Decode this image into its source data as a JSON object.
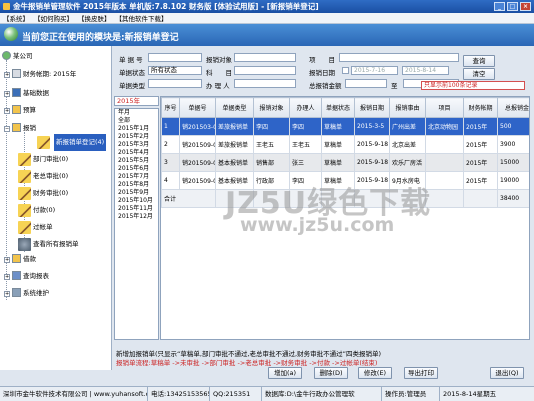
{
  "window": {
    "title": "金牛报销单管理软件 2015年版本 单机版:7.8.102 财务版 [体验试用版] - [新报销单登记]"
  },
  "menu": [
    "【系统】",
    "【如何购买】",
    "【换皮肤】",
    "【其他软件下载】"
  ],
  "header": {
    "module_text": "当前您正在使用的模块是:新报销单登记"
  },
  "nav": {
    "root": "某公司",
    "period": "财务帐期: 2015年",
    "basic": "基础数据",
    "budget": "预算",
    "reimburse": "报销",
    "sub_items": [
      "新报销单登记(4)",
      "部门审批(0)",
      "老总审批(0)",
      "财务审批(0)",
      "付款(0)",
      "过帐单",
      "查看所有报销单"
    ],
    "loan": "借款",
    "reports": "查询报表",
    "maintenance": "系统维护"
  },
  "filter": {
    "bill_no_label": "单 据 号",
    "status_label": "单据状态",
    "status_value": "所有状态",
    "type_label": "单据类型",
    "target_label": "报销对象",
    "subject_label": "科　　目",
    "handler_label": "办 理 人",
    "item_label": "项　　目",
    "date_label": "报销日期",
    "date_from": "2015-7-16",
    "date_to": "2015-8-14",
    "amount_label": "总报销金额",
    "amount_to": "至",
    "query_button": "查询",
    "clear_button": "清空",
    "limit_text": "只显示前100条记录"
  },
  "year_select": "2015年",
  "months": [
    "年月",
    "全部",
    "2015年1月",
    "2015年2月",
    "2015年3月",
    "2015年4月",
    "2015年5月",
    "2015年6月",
    "2015年7月",
    "2015年8月",
    "2015年9月",
    "2015年10月",
    "2015年11月",
    "2015年12月"
  ],
  "table": {
    "headers": [
      "序号",
      "单据号",
      "单据类型",
      "报销对象",
      "办理人",
      "单据状态",
      "报销日期",
      "报销事由",
      "项目",
      "财务帐期",
      "总报销金"
    ],
    "rows": [
      [
        "1",
        "销201503-0",
        "差旅报销单",
        "李四",
        "李四",
        "草稿单",
        "2015-3-5",
        "广州出差",
        "北京动物园",
        "2015年",
        "500"
      ],
      [
        "2",
        "销201509-0",
        "差旅报销单",
        "王老五",
        "王老五",
        "草稿单",
        "2015-9-18",
        "北京出差",
        "",
        "2015年",
        "3900"
      ],
      [
        "3",
        "销201509-0",
        "基本报销单",
        "销售部",
        "张三",
        "草稿单",
        "2015-9-18",
        "欢乐厂房活",
        "",
        "2015年",
        "15000"
      ],
      [
        "4",
        "销201509-0",
        "基本报销单",
        "行政部",
        "李四",
        "草稿单",
        "2015-9-18",
        "9月水房电",
        "",
        "2015年",
        "19000"
      ]
    ],
    "total_label": "合计",
    "total_value": "38400"
  },
  "watermark": {
    "line1": "JZ5U绿色下载",
    "line2": "www.jz5u.com"
  },
  "hint": {
    "line1": "新增加报销单(只显示“草稿单,部门审批不通过,老总审批不通过,财务审批不通过”四类报销单)",
    "line2": "报销单流程:草稿单 ->未审批 ->部门审批 ->老总审批 ->财务审批 ->付款 ->过帐单(结束)"
  },
  "actions": {
    "add": "增加(a)",
    "delete": "删除(D)",
    "modify": "修改(E)",
    "print": "导出打印",
    "exit": "退出(Q)"
  },
  "status": {
    "company": "深圳市金牛软件技术有限公司 | www.yuhansoft.com",
    "phone": "电话:13425153565",
    "qq": "QQ:215351",
    "db": "数据库:D:\\金牛行政办公管理软",
    "operator": "操作员:管理员",
    "date": "2015-8-14星期五"
  },
  "colors": {
    "accent": "#2e64c8",
    "warning": "#cc2222"
  }
}
